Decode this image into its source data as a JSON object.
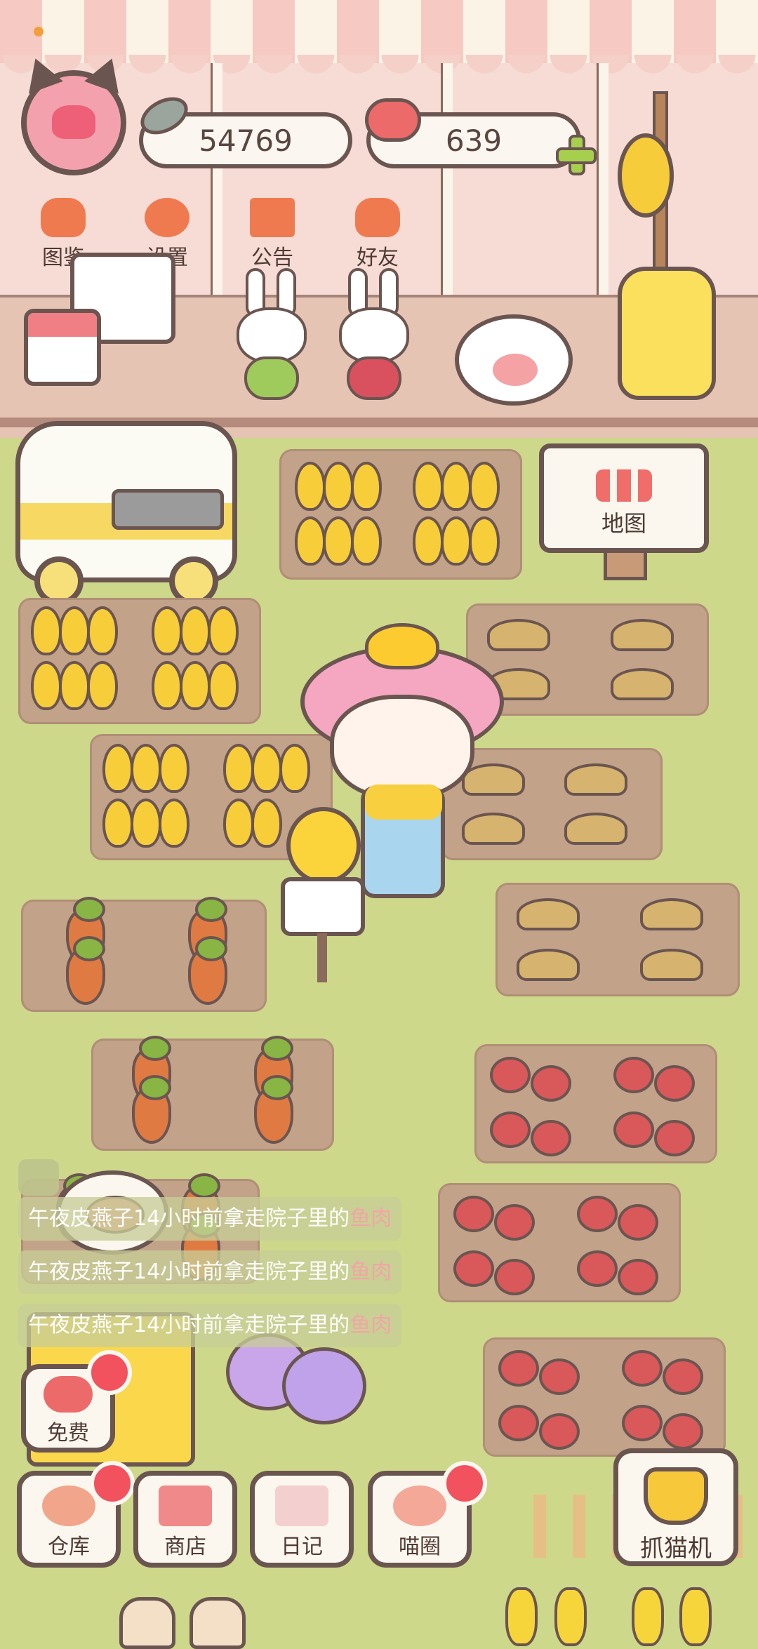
{
  "hud": {
    "fish_count": "54769",
    "heart_count": "639"
  },
  "top_menu": [
    {
      "label": "图鉴",
      "icon": "cat-face-icon",
      "color": "#f07a50"
    },
    {
      "label": "设置",
      "icon": "gear-icon",
      "color": "#f07a50"
    },
    {
      "label": "公告",
      "icon": "gift-icon",
      "color": "#f07a50"
    },
    {
      "label": "好友",
      "icon": "friends-icon",
      "color": "#f07a50"
    }
  ],
  "map_sign": {
    "label": "地图"
  },
  "messages": [
    {
      "prefix": "午夜皮燕子14小时前拿走院子里的",
      "item": "鱼肉"
    },
    {
      "prefix": "午夜皮燕子14小时前拿走院子里的",
      "item": "鱼肉"
    },
    {
      "prefix": "午夜皮燕子14小时前拿走院子里的",
      "item": "鱼肉"
    }
  ],
  "free_button": {
    "label": "免费",
    "has_badge": true
  },
  "bottom_bar": [
    {
      "label": "仓库",
      "icon": "storage-bowl-icon",
      "has_badge": true
    },
    {
      "label": "商店",
      "icon": "shop-icon",
      "has_badge": false
    },
    {
      "label": "日记",
      "icon": "diary-icon",
      "has_badge": false
    },
    {
      "label": "喵圈",
      "icon": "cat-planet-icon",
      "has_badge": true
    }
  ],
  "claw_machine": {
    "label": "抓猫机"
  },
  "colors": {
    "outline": "#6b5550",
    "ground": "#cdd88a",
    "soil": "#c3a28a",
    "badge": "#f2525e",
    "panel": "#fbf7ef"
  }
}
